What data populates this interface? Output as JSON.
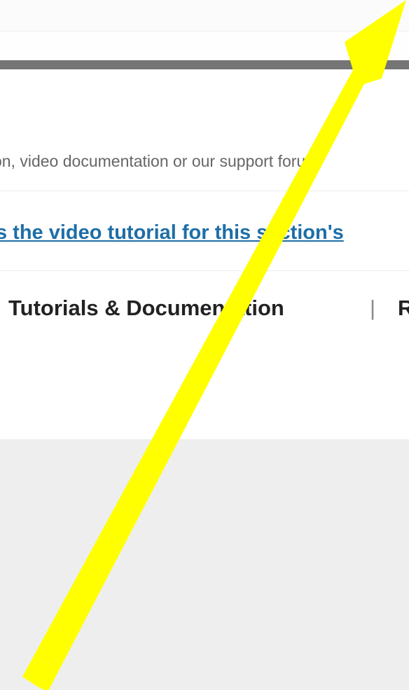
{
  "progress": {
    "fraction": 1.0,
    "color": "#757575"
  },
  "help": {
    "text": "on, video documentation or our support foru"
  },
  "video_link": {
    "label": "s the video tutorial for this section's"
  },
  "nav": {
    "tutorials_label": "Tutorials & Documentation",
    "divider": "|",
    "next_label": "R"
  },
  "annotation": {
    "shape": "arrow-icon",
    "direction": "up-right",
    "color": "#ffff00"
  },
  "colors": {
    "link": "#1e6ea7",
    "footer_bg": "#eeeeee"
  }
}
